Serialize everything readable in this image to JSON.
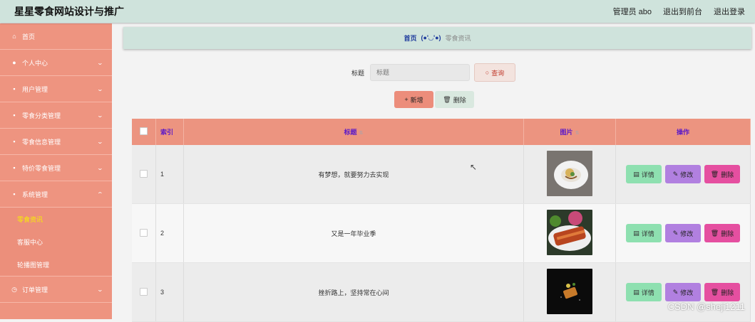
{
  "header": {
    "title": "星星零食网站设计与推广",
    "admin": "管理员 abo",
    "to_front": "退出到前台",
    "logout": "退出登录"
  },
  "sidebar": {
    "items": [
      {
        "label": "首页",
        "icon": "home-icon",
        "glyph": "⌂"
      },
      {
        "label": "个人中心",
        "icon": "user-icon",
        "glyph": "●"
      },
      {
        "label": "用户管理",
        "icon": "users-icon",
        "glyph": "▪"
      },
      {
        "label": "零食分类管理",
        "icon": "clipboard-icon",
        "glyph": "▪"
      },
      {
        "label": "零食信息管理",
        "icon": "briefcase-icon",
        "glyph": "▪"
      },
      {
        "label": "特价零食管理",
        "icon": "card-icon",
        "glyph": "▪"
      },
      {
        "label": "系统管理",
        "icon": "clipboard-icon",
        "glyph": "▪"
      }
    ],
    "sub_items": [
      "零食资讯",
      "客服中心",
      "轮播图管理"
    ],
    "last_item": {
      "label": "订单管理",
      "icon": "clock-icon",
      "glyph": "◷"
    }
  },
  "breadcrumb": {
    "home": "首页",
    "face": "(●'◡'●)",
    "current": "零食资讯"
  },
  "search": {
    "label": "标题",
    "placeholder": "标题",
    "button": "查询"
  },
  "actions": {
    "add": "新增",
    "delete": "删除"
  },
  "table": {
    "headers": {
      "index": "索引",
      "title": "标题",
      "image": "图片",
      "ops": "操作"
    },
    "rows": [
      {
        "index": "1",
        "title": "有梦想，就要努力去实现"
      },
      {
        "index": "2",
        "title": "又是一年毕业季"
      },
      {
        "index": "3",
        "title": "挫折路上，坚持常在心间"
      }
    ],
    "row_buttons": {
      "detail": "详情",
      "edit": "修改",
      "remove": "删除"
    }
  },
  "watermark": "CSDN @sheji1211",
  "colors": {
    "sidebar": "#ee9480",
    "header": "#cfe3dc",
    "detail": "#8ee0b0",
    "edit": "#b180e0",
    "remove": "#e54fa0"
  }
}
